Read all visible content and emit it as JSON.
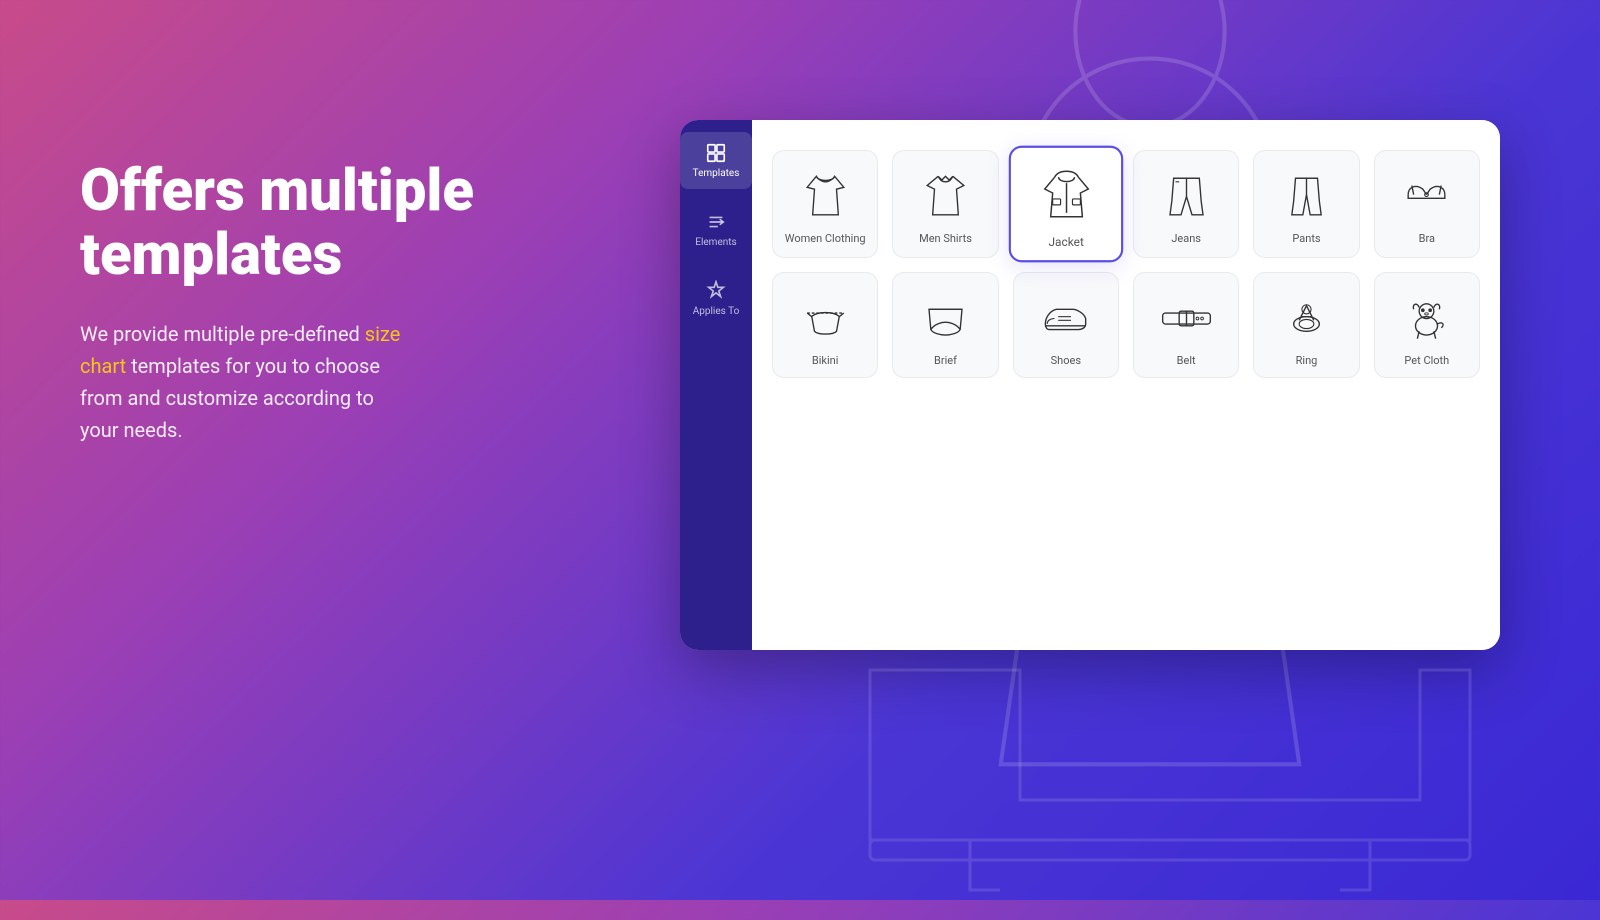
{
  "background": {
    "gradient_start": "#c84b8a",
    "gradient_end": "#3a28d4"
  },
  "hero": {
    "heading": "Offers multiple templates",
    "description_before": "We provide multiple pre-defined ",
    "highlight1": "size",
    "newline": "\n",
    "highlight2": "chart",
    "description_after": " templates for you to choose from and customize according to your needs.",
    "highlight_color": "#f5c518"
  },
  "sidebar": {
    "items": [
      {
        "id": "templates",
        "label": "Templates",
        "active": true
      },
      {
        "id": "elements",
        "label": "Elements",
        "active": false
      },
      {
        "id": "applies-to",
        "label": "Applies To",
        "active": false
      }
    ]
  },
  "templates_grid": {
    "rows": [
      [
        {
          "id": "women-clothing",
          "label": "Women Clothing",
          "selected": false
        },
        {
          "id": "men-shirts",
          "label": "Men Shirts",
          "selected": false
        },
        {
          "id": "jacket",
          "label": "Jacket",
          "selected": true
        },
        {
          "id": "jeans",
          "label": "Jeans",
          "selected": false
        },
        {
          "id": "pants",
          "label": "Pants",
          "selected": false
        },
        {
          "id": "bra",
          "label": "Bra",
          "selected": false
        }
      ],
      [
        {
          "id": "bikini",
          "label": "Bikini",
          "selected": false
        },
        {
          "id": "brief",
          "label": "Brief",
          "selected": false
        },
        {
          "id": "shoes",
          "label": "Shoes",
          "selected": false
        },
        {
          "id": "belt",
          "label": "Belt",
          "selected": false
        },
        {
          "id": "ring",
          "label": "Ring",
          "selected": false
        },
        {
          "id": "pet-cloth",
          "label": "Pet Cloth",
          "selected": false
        }
      ]
    ]
  }
}
